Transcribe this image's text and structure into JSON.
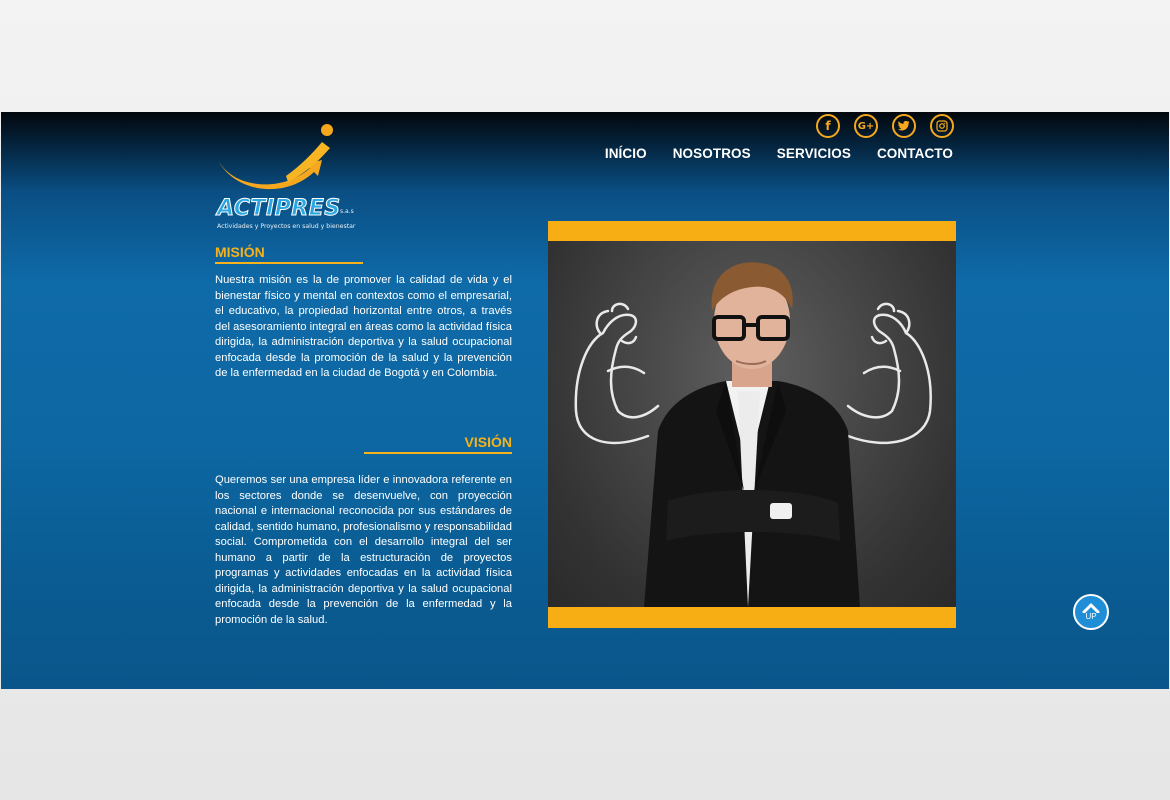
{
  "social": {
    "facebook": "f",
    "googleplus": "G+",
    "icons": [
      "facebook-icon",
      "google-plus-icon",
      "twitter-icon",
      "instagram-icon"
    ]
  },
  "nav": {
    "items": [
      {
        "label": "INÍCIO"
      },
      {
        "label": "NOSOTROS"
      },
      {
        "label": "SERVICIOS"
      },
      {
        "label": "CONTACTO"
      }
    ]
  },
  "logo": {
    "name": "ACTIPRES",
    "suffix": "s.a.s",
    "tagline": "Actividades y Proyectos en salud y bienestar"
  },
  "mision": {
    "title": "MISIÓN",
    "text": "Nuestra misión es la de promover la calidad de vida y el bienestar físico y mental en contextos como el empresarial, el educativo, la propiedad horizontal entre otros, a través del asesoramiento integral en áreas como la actividad física dirigida, la administración deportiva y la salud ocupacional enfocada desde la promoción de la salud y la prevención de la enfermedad en la ciudad de Bogotá y en Colombia."
  },
  "vision": {
    "title": "VISIÓN",
    "text": "Queremos ser una empresa líder e innovadora referente en los sectores donde se desenvuelve, con proyección nacional e internacional reconocida por sus estándares de calidad, sentido humano, profesionalismo y responsabilidad social. Comprometida con el desarrollo integral del ser humano a partir de la estructuración de proyectos programas y actividades enfocadas en la actividad física dirigida, la administración deportiva y la salud ocupacional enfocada desde la prevención de la enfermedad y la promoción de la salud."
  },
  "up_button": {
    "label": "UP"
  },
  "colors": {
    "accent": "#f5b21b",
    "brand_blue": "#0f6aa8",
    "frame": "#f6ae14"
  }
}
